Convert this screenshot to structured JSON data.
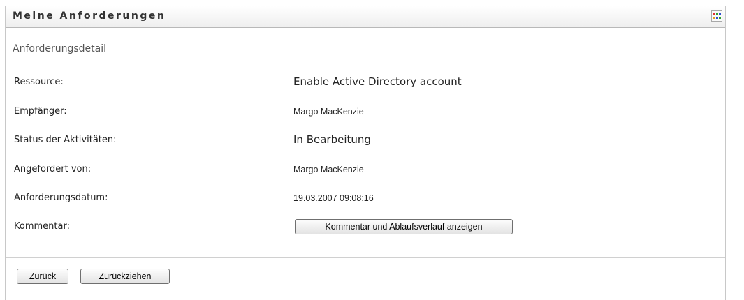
{
  "portlet": {
    "title": "Meine Anforderungen",
    "menu_icon": "grid-menu-icon"
  },
  "subheader": {
    "title": "Anforderungsdetail"
  },
  "details": {
    "resource_label": "Ressource:",
    "resource_value": "Enable Active Directory account",
    "recipient_label": "Empfänger:",
    "recipient_value": "Margo MacKenzie",
    "status_label": "Status der Aktivitäten:",
    "status_value": "In Bearbeitung",
    "requested_by_label": "Angefordert von:",
    "requested_by_value": "Margo MacKenzie",
    "request_date_label": "Anforderungsdatum:",
    "request_date_value": "19.03.2007 09:08:16",
    "comment_label": "Kommentar:",
    "comment_button": "Kommentar und Ablaufsverlauf anzeigen"
  },
  "footer": {
    "back_button": "Zurück",
    "withdraw_button": "Zurückziehen"
  },
  "colors": {
    "border": "#c8c8c8",
    "title_text": "#333333",
    "menu_icon_colors": [
      "#e03030",
      "#30a030",
      "#3050d0",
      "#e0a020"
    ]
  }
}
